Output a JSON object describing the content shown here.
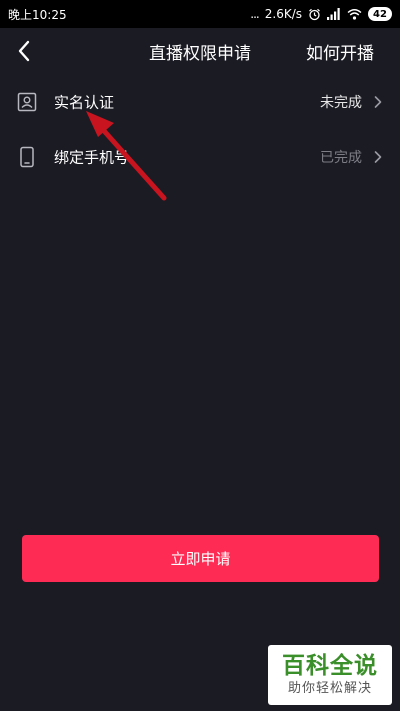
{
  "status_bar": {
    "time": "晚上10:25",
    "dots": "...",
    "network_speed": "2.6K/s",
    "battery": "42",
    "icons": [
      "alarm-icon",
      "signal-icon",
      "wifi-icon",
      "battery-icon"
    ]
  },
  "header": {
    "title": "直播权限申请",
    "how_to": "如何开播",
    "back_icon": "chevron-left-icon"
  },
  "items": [
    {
      "label": "实名认证",
      "status": "未完成",
      "status_color": "#e6e6e6",
      "icon": "id-card-icon"
    },
    {
      "label": "绑定手机号",
      "status": "已完成",
      "status_color": "#7d7d86",
      "icon": "phone-icon"
    }
  ],
  "apply_button": {
    "label": "立即申请",
    "color": "#fe2c55"
  },
  "watermark": {
    "title": "百科全说",
    "subtitle": "助你轻松解决"
  },
  "colors": {
    "background": "#1b1b24",
    "annotation_arrow": "#c8141e"
  }
}
